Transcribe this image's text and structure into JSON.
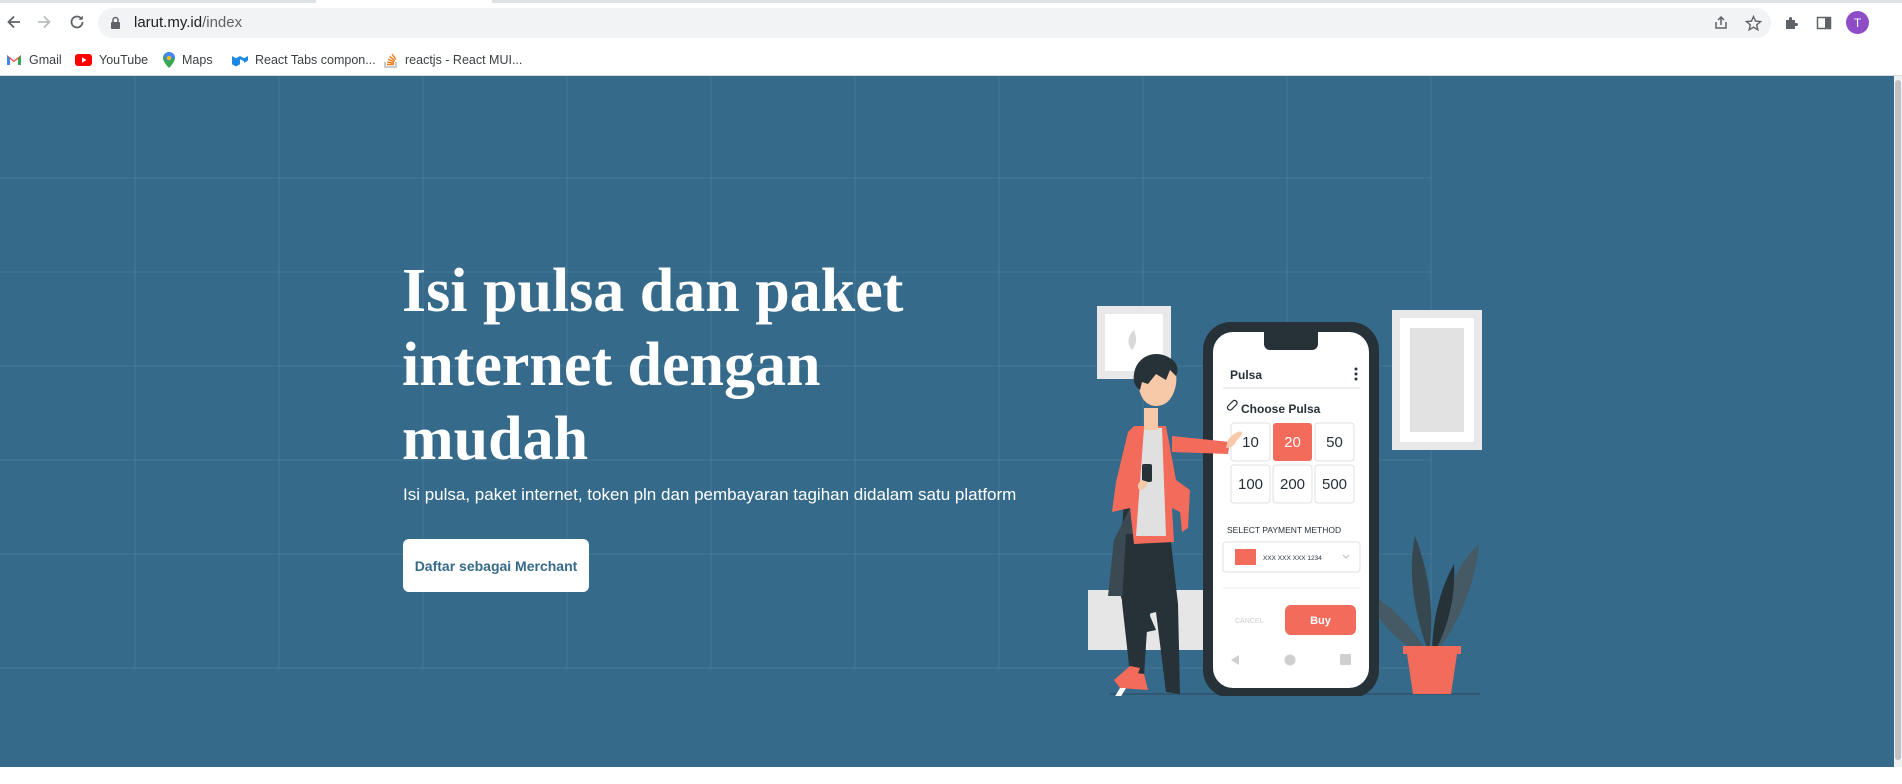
{
  "browser": {
    "url_host": "larut.my.id",
    "url_path": "/index",
    "profile_initial": "T",
    "bookmarks": [
      {
        "label": "Gmail",
        "icon": "gmail-icon"
      },
      {
        "label": "YouTube",
        "icon": "youtube-icon"
      },
      {
        "label": "Maps",
        "icon": "maps-icon"
      },
      {
        "label": "React Tabs compon...",
        "icon": "mui-icon"
      },
      {
        "label": "reactjs - React MUI...",
        "icon": "stackoverflow-icon"
      }
    ]
  },
  "hero": {
    "headline": "Isi pulsa dan paket internet dengan mudah",
    "subline": "Isi pulsa, paket internet, token pln dan pembayaran tagihan didalam satu platform",
    "cta_label": "Daftar sebagai Merchant",
    "background_color": "#356a8a"
  },
  "illustration": {
    "header": "Pulsa",
    "section_title": "Choose Pulsa",
    "amounts": [
      "10",
      "20",
      "50",
      "100",
      "200",
      "500"
    ],
    "selected_amount": "20",
    "payment_label": "SELECT PAYMENT METHOD",
    "card_number": "XXX XXX XXX 1234",
    "cancel_label": "CANCEL",
    "buy_label": "Buy",
    "accent_color": "#f26b5b"
  }
}
